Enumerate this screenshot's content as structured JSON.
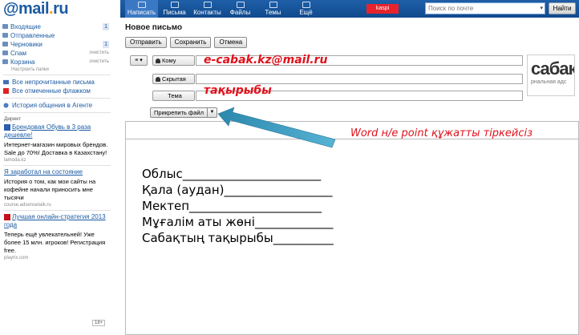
{
  "logo": {
    "at": "@",
    "name": "mail",
    "dot": ".",
    "tld": "ru"
  },
  "nav": [
    {
      "label": "Написать",
      "icon": "compose-icon"
    },
    {
      "label": "Письма",
      "icon": "mail-icon"
    },
    {
      "label": "Контакты",
      "icon": "contacts-icon"
    },
    {
      "label": "Файлы",
      "icon": "files-icon"
    },
    {
      "label": "Темы",
      "icon": "themes-icon"
    },
    {
      "label": "Ещё",
      "icon": "more-icon"
    }
  ],
  "banner_label": "kaspi",
  "search": {
    "placeholder": "Поиск по почте",
    "button": "Найти"
  },
  "folders": [
    {
      "label": "Входящие",
      "count": "1"
    },
    {
      "label": "Отправленные",
      "count": ""
    },
    {
      "label": "Черновики",
      "count": "1"
    },
    {
      "label": "Спам",
      "action": "очистить"
    },
    {
      "label": "Корзина",
      "action": "очистить"
    }
  ],
  "settings_link": "Настроить папки",
  "filters": [
    "Все непрочитанные письма",
    "Все отмеченные флажком"
  ],
  "agent_history": "История общения в Агенте",
  "direct_label": "Директ",
  "ads": [
    {
      "title": "Брендовая Обувь в 3 раза дешевле!",
      "text": "Интернет-магазин мировых брендов. Sale до 70%! Доставка в Казахстану!",
      "url": "lamoda.kz"
    },
    {
      "title": "Я заработал на состояние",
      "text": "История о том, как мои сайты на кофейне начали приносить мне тысячи",
      "url": "course.adsensetalk.ru"
    },
    {
      "title": "Лучшая онлайн-стратегия 2013 года",
      "text": "Теперь ещё увлекательней! Уже более 15 млн. игроков! Регистрация free.",
      "url": "playrix.com"
    }
  ],
  "age_badge": "18+",
  "compose": {
    "title": "Новое письмо",
    "buttons": [
      "Отправить",
      "Сохранить",
      "Отмена"
    ],
    "menu_glyph": "≡ ▾",
    "to_label": "Кому",
    "bcc_label": "Скрытая",
    "subject_label": "Тема",
    "to_value": "e-cabak.kz@mail.ru",
    "subject_value": "тақырыбы",
    "attach_button": "Прикрепить файл",
    "attach_hint": "Word н/е point құжатты тіркейсіз",
    "side_ad_big": "сабак",
    "side_ad_small": "рнальная адс"
  },
  "body_lines": [
    "Облыс_______________________",
    "Қала (аудан)__________________",
    "Мектеп______________________",
    "Мұғалім аты жөні_____________",
    "Сабақтың тақырыбы__________"
  ],
  "colors": {
    "brand_blue": "#1b5aa3",
    "accent_red": "#e0111c",
    "arrow": "#3a93b5"
  }
}
